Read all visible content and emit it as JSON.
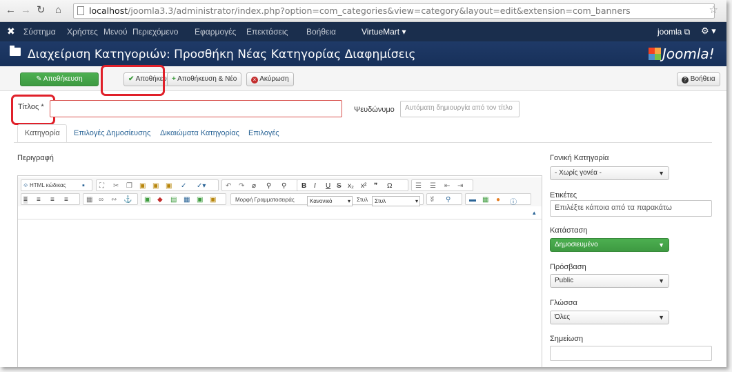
{
  "browser": {
    "url_host": "localhost",
    "url_path": "/joomla3.3/administrator/index.php?option=com_categories&view=category&layout=edit&extension=com_banners"
  },
  "topnav": {
    "items": [
      "Σύστημα",
      "Χρήστες",
      "Μενού",
      "Περιεχόμενο",
      "Εφαρμογές",
      "Επεκτάσεις",
      "Βοήθεια"
    ],
    "virtuemart": "VirtueMart ▾",
    "user": "joomla ⧉"
  },
  "header": {
    "title": "Διαχείριση Κατηγοριών: Προσθήκη Νέας Κατηγορίας Διαφημίσεις",
    "logo_text": "Joomla!"
  },
  "toolbar": {
    "save": "Αποθήκευση",
    "save_close": "Αποθήκευση",
    "save_new": "Αποθήκευση & Νέο",
    "cancel": "Ακύρωση",
    "help": "Βοήθεια"
  },
  "form": {
    "title_label": "Τίτλος *",
    "title_value": "",
    "alias_label": "Ψευδώνυμο",
    "alias_placeholder": "Αυτόματη δημιουργία από τον τίτλο"
  },
  "tabs": [
    "Κατηγορία",
    "Επιλογές Δημοσίευσης",
    "Δικαιώματα Κατηγορίας",
    "Επιλογές"
  ],
  "description_label": "Περιγραφή",
  "editor": {
    "html_btn": "HTML κώδικας",
    "font_format_label": "Μορφή Γραμματοσειράς",
    "font_format_value": "Κανονικό",
    "style_label": "Στυλ",
    "style_value": "Στυλ"
  },
  "sidebar": {
    "parent_label": "Γονική Κατηγορία",
    "parent_value": "- Χωρίς γονέα -",
    "tags_label": "Ετικέτες",
    "tags_placeholder": "Επιλέξτε κάποια από τα παρακάτω",
    "status_label": "Κατάσταση",
    "status_value": "Δημοσιευμένο",
    "access_label": "Πρόσβαση",
    "access_value": "Public",
    "language_label": "Γλώσσα",
    "language_value": "Όλες",
    "note_label": "Σημείωση",
    "note_value": ""
  },
  "colors": {
    "nav_bg": "#1a2e4d",
    "title_bg": "#1f3a68",
    "green": "#46a546",
    "highlight": "#e0202a",
    "link": "#2a6496"
  }
}
